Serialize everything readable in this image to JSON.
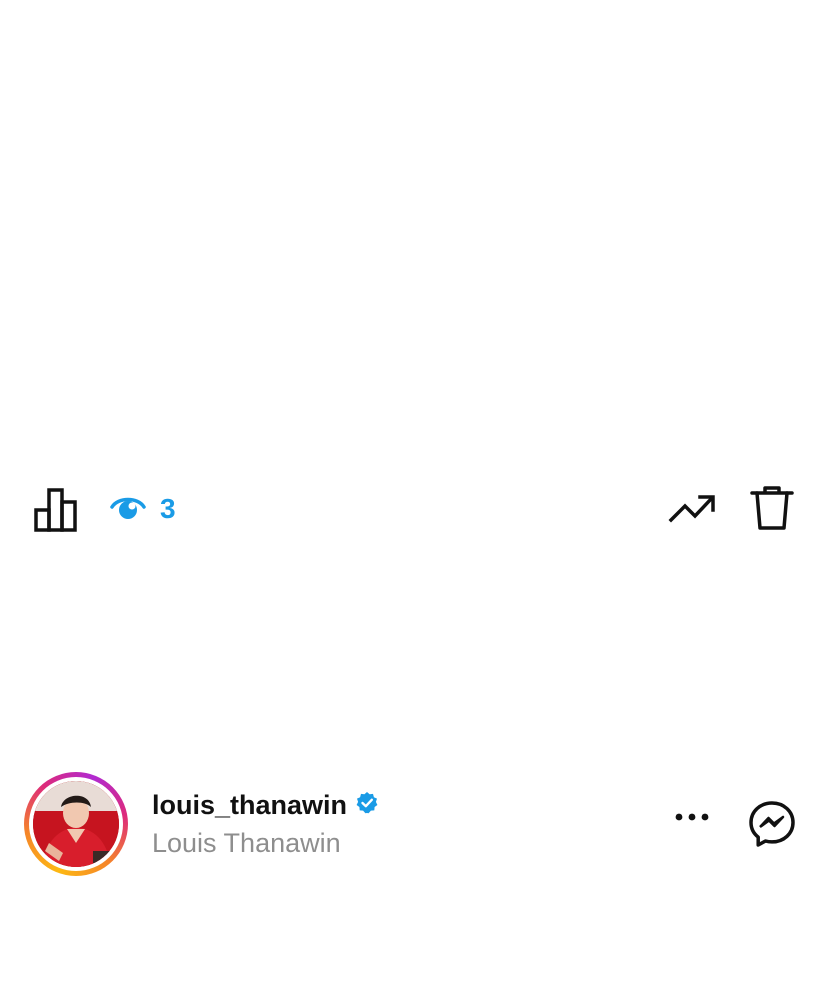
{
  "activity": {
    "view_count": "3",
    "icons": [
      "bar-chart-icon",
      "eye-icon",
      "trending-up-icon",
      "trash-icon"
    ],
    "accent_color": "#1a9be6"
  },
  "profile": {
    "username": "louis_thanawin",
    "display_name": "Louis Thanawin",
    "verified": true,
    "verified_color": "#1a9be6",
    "story_ring_colors": [
      "#fdb813",
      "#f58529",
      "#dd2a7b",
      "#b12ad1"
    ],
    "icons": [
      "more-icon",
      "messenger-icon"
    ]
  }
}
